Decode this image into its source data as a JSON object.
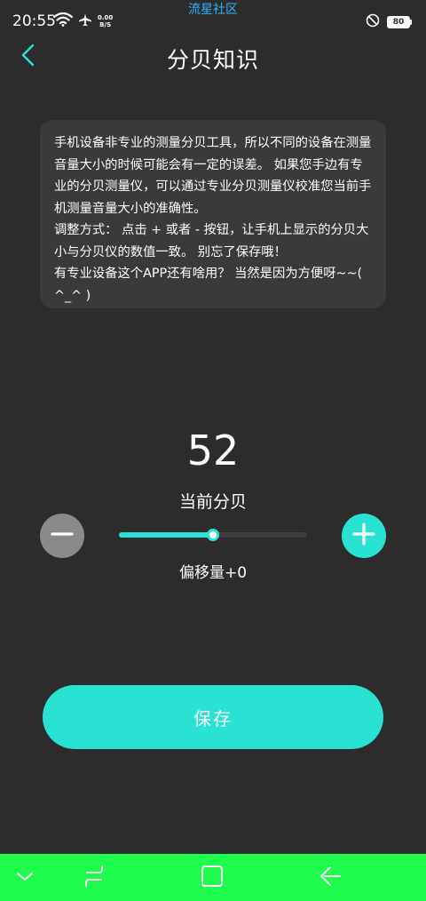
{
  "status_bar": {
    "time": "20:55",
    "net_speed_value": "0.00",
    "net_speed_unit": "B/S",
    "notice": "流星社区",
    "battery": "80"
  },
  "header": {
    "title": "分贝知识"
  },
  "info_card": {
    "paragraph_1": "手机设备非专业的测量分贝工具，所以不同的设备在测量音量大小的时候可能会有一定的误差。 如果您手边有专业的分贝测量仪，可以通过专业分贝测量仪校准您当前手机测量音量大小的准确性。",
    "paragraph_2": " 调整方式： 点击 + 或者 - 按钮，让手机上显示的分贝大小与分贝仪的数值一致。 别忘了保存哦！",
    "paragraph_3": " 有专业设备这个APP还有啥用？ 当然是因为方便呀~~( ^_^ )"
  },
  "meter": {
    "value": "52",
    "label": "当前分贝",
    "offset_label": "偏移量+0",
    "slider_fraction": 0.5
  },
  "save_label": "保存",
  "colors": {
    "accent": "#29e2d4",
    "background": "#2c2c2c",
    "card": "#3a3a3a",
    "minus": "#8a8a8a",
    "nav_bar": "#1efc4c"
  },
  "icons": {
    "back": "chevron-left-icon",
    "minus": "minus-icon",
    "plus": "plus-icon",
    "nav_collapse": "chevron-down-icon",
    "nav_recents": "recents-icon",
    "nav_home": "home-icon",
    "nav_back": "back-arrow-icon"
  }
}
